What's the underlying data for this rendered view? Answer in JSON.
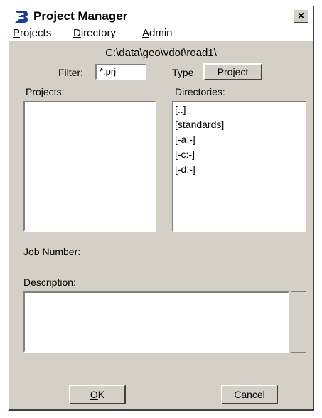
{
  "window": {
    "title": "Project Manager",
    "close_label": "×"
  },
  "menu": [
    {
      "label": "Projects",
      "mnemonic": "P",
      "rest": "rojects"
    },
    {
      "label": "Directory",
      "mnemonic": "D",
      "rest": "irectory"
    },
    {
      "label": "Admin",
      "mnemonic": "A",
      "rest": "dmin"
    }
  ],
  "current_path": "C:\\data\\geo\\vdot\\road1\\",
  "filter": {
    "label": "Filter:",
    "value": "*.prj"
  },
  "type": {
    "label": "Type",
    "value": "Project"
  },
  "projects": {
    "label": "Projects:",
    "items": []
  },
  "directories": {
    "label": "Directories:",
    "items": [
      "[..]",
      "[standards]",
      "[-a:-]",
      "[-c:-]",
      "[-d:-]"
    ]
  },
  "job_number": {
    "label": "Job Number:"
  },
  "description": {
    "label": "Description:",
    "value": ""
  },
  "buttons": {
    "ok": {
      "label": "OK",
      "mnemonic": "O",
      "rest": "K"
    },
    "cancel": {
      "label": "Cancel"
    }
  }
}
